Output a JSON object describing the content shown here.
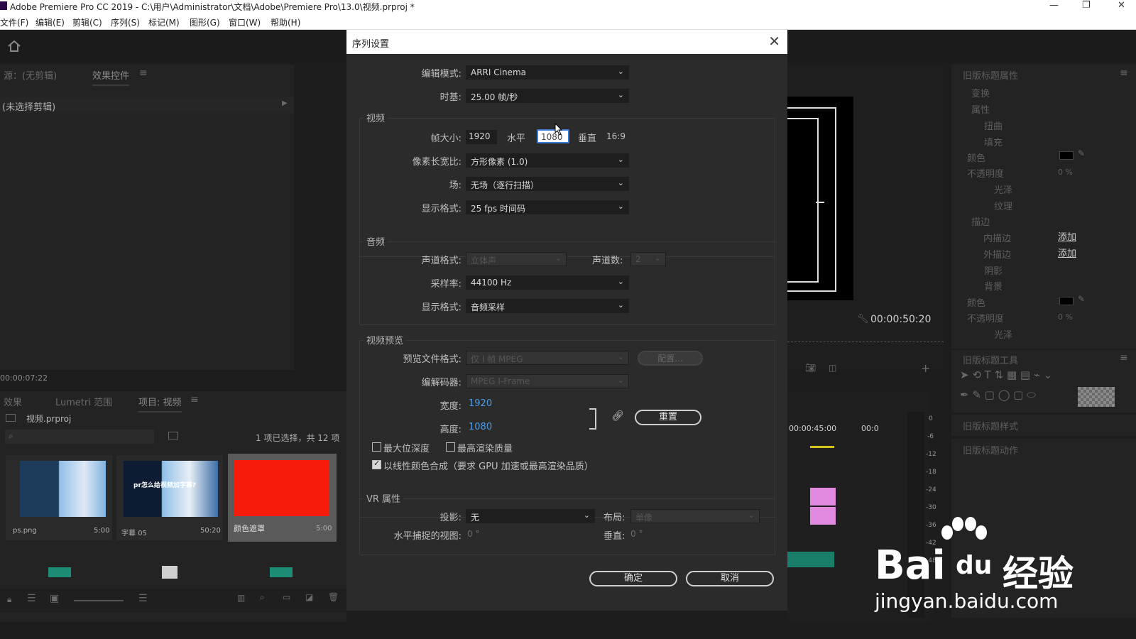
{
  "window": {
    "title": "Adobe Premiere Pro CC 2019 - C:\\用户\\Administrator\\文档\\Adobe\\Premiere Pro\\13.0\\视频.prproj *",
    "minimize": "—",
    "restore": "❐",
    "close": "✕"
  },
  "menu": [
    "文件(F)",
    "编辑(E)",
    "剪辑(C)",
    "序列(S)",
    "标记(M)",
    "图形(G)",
    "窗口(W)",
    "帮助(H)"
  ],
  "source_panel": {
    "tab_source": "源：(无剪辑)",
    "tab_effect_controls": "效果控件",
    "no_clip": "(未选择剪辑)",
    "timecode": "00:00:07:22"
  },
  "project_panel": {
    "tab_effects": "效果",
    "tab_lumetri": "Lumetri 范围",
    "tab_project": "项目: 视频",
    "project_file": "视频.prproj",
    "selection_info": "1 项已选择，共 12 项",
    "items": [
      {
        "name": "ps.png",
        "duration": "5:00"
      },
      {
        "name": "字幕 05",
        "duration": "50:20",
        "caption": "pr怎么给视频加字幕?"
      },
      {
        "name": "颜色遮罩",
        "duration": "5:00"
      }
    ]
  },
  "program_monitor": {
    "timecode": "00:00:50:20",
    "timeline_time1": "00:00:45:00",
    "timeline_time2": "00:0",
    "meter_labels": [
      "0",
      "-6",
      "-12",
      "-18",
      "-24",
      "-30",
      "-36",
      "-42",
      "-48"
    ]
  },
  "right_panel": {
    "title": "旧版标题属性",
    "items": [
      "变换",
      "属性",
      "扭曲",
      "填充",
      "颜色",
      "不透明度",
      "光泽",
      "纹理",
      "描边",
      "内描边",
      "外描边",
      "阴影",
      "背景",
      "颜色",
      "不透明度",
      "光泽"
    ],
    "opacity_value": "0 %",
    "add_label": "添加",
    "tools_title": "旧版标题工具",
    "styles_title": "旧版标题样式",
    "actions_title": "旧版标题动作"
  },
  "dialog": {
    "title": "序列设置",
    "edit_mode_label": "编辑模式:",
    "edit_mode": "ARRI Cinema",
    "timebase_label": "时基:",
    "timebase": "25.00 帧/秒",
    "video_group": "视频",
    "frame_size_label": "帧大小:",
    "frame_width": "1920",
    "horizontal": "水平",
    "frame_height": "1080",
    "vertical": "垂直",
    "aspect": "16:9",
    "pixel_aspect_label": "像素长宽比:",
    "pixel_aspect": "方形像素 (1.0)",
    "field_label": "场:",
    "field": "无场（逐行扫描）",
    "video_display_label": "显示格式:",
    "video_display": "25 fps 时间码",
    "audio_group": "音频",
    "channel_format_label": "声道格式:",
    "channel_format": "立体声",
    "channel_count_label": "声道数:",
    "channel_count": "2",
    "sample_rate_label": "采样率:",
    "sample_rate": "44100 Hz",
    "audio_display_label": "显示格式:",
    "audio_display": "音频采样",
    "preview_group": "视频预览",
    "preview_format_label": "预览文件格式:",
    "preview_format": "仅 I 帧 MPEG",
    "configure": "配置...",
    "codec_label": "编解码器:",
    "codec": "MPEG I-Frame",
    "width_label": "宽度:",
    "width_value": "1920",
    "height_label": "高度:",
    "height_value": "1080",
    "reset": "重置",
    "max_bit_depth": "最大位深度",
    "max_render_quality": "最高渲染质量",
    "linear_color": "以线性颜色合成（要求 GPU 加速或最高渲染品质）",
    "vr_group": "VR 属性",
    "projection_label": "投影:",
    "projection": "无",
    "layout_label": "布局:",
    "layout": "单像",
    "h_view_label": "水平捕捉的视图:",
    "h_view": "0 °",
    "v_view_label": "垂直:",
    "v_view": "0 °",
    "ok": "确定",
    "cancel": "取消"
  },
  "watermark": {
    "brand": "Bai",
    "brand2": "du",
    "cn": "经验",
    "url": "jingyan.baidu.com"
  }
}
